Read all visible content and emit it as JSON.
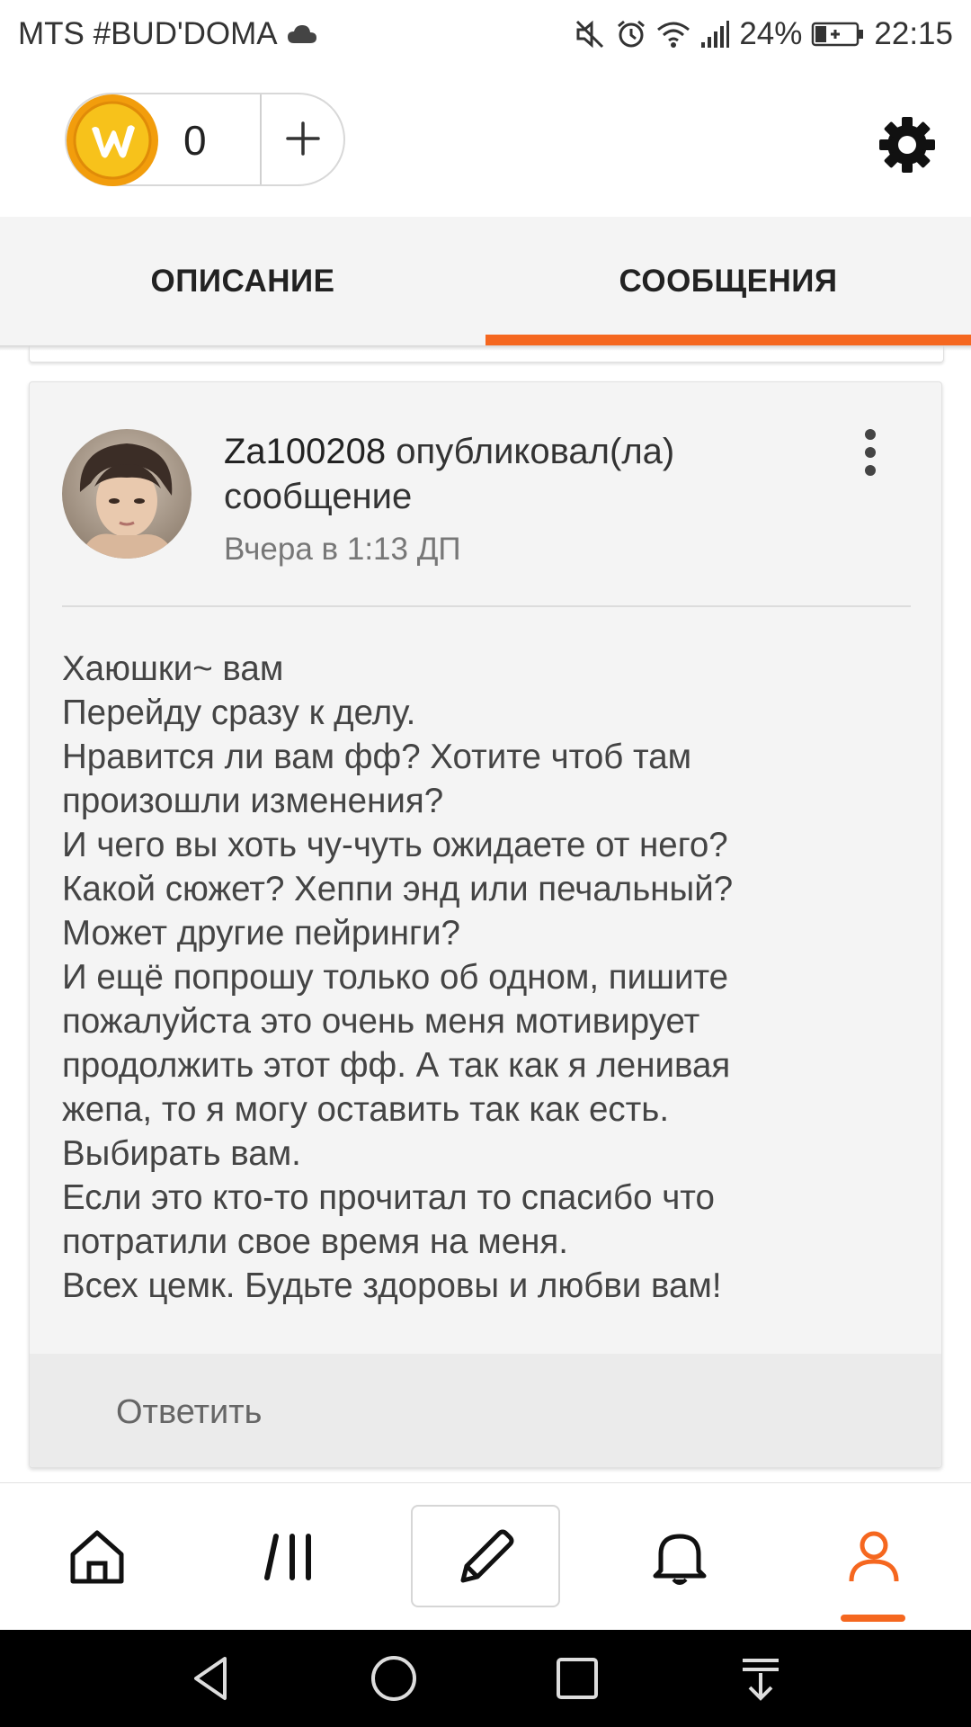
{
  "status_bar": {
    "carrier": "MTS #BUD'DOMA",
    "battery": "24%",
    "time": "22:15",
    "icons": [
      "cloud-icon",
      "mute-icon",
      "alarm-icon",
      "wifi-icon",
      "signal-icon",
      "battery-icon"
    ]
  },
  "topbar": {
    "coin_count": "0",
    "coin_icon": "wattpad-coin-icon",
    "add_icon": "plus-icon",
    "settings_icon": "gear-icon"
  },
  "tabs": [
    {
      "label": "ОПИСАНИЕ",
      "active": false
    },
    {
      "label": "СООБЩЕНИЯ",
      "active": true
    }
  ],
  "message": {
    "author": "Za100208",
    "action": "опубликовал(ла) сообщение",
    "timestamp": "Вчера в 1:13 ДП",
    "body_lines": [
      "Хаюшки~ вам",
      "Перейду сразу к делу.",
      "Нравится ли вам фф? Хотите чтоб там",
      "произошли изменения?",
      "И чего вы хоть чу-чуть ожидаете от него?",
      "Какой сюжет? Хеппи энд или печальный?",
      "Может другие пейринги?",
      "И ещё попрошу только об одном, пишите",
      "пожалуйста это очень меня мотивирует",
      "продолжить этот фф. А так как я ленивая",
      "жепа, то я могу оставить так как есть.",
      "Выбирать вам.",
      "Если это кто-то прочитал то спасибо что",
      "потратили свое время на меня.",
      "Всех цемк. Будьте здоровы и любви вам!"
    ],
    "reply_label": "Ответить"
  },
  "bottom_nav": [
    {
      "icon": "home-icon",
      "active": false
    },
    {
      "icon": "library-icon",
      "active": false
    },
    {
      "icon": "pencil-icon",
      "active": false
    },
    {
      "icon": "bell-icon",
      "active": false
    },
    {
      "icon": "profile-icon",
      "active": true
    }
  ],
  "system_nav": [
    "back-icon",
    "home-circle-icon",
    "recents-icon",
    "notification-pull-icon"
  ],
  "colors": {
    "accent": "#f5671f",
    "coin": "#f5b50f",
    "tab_bg": "#f4f4f4",
    "card_bg": "#f4f4f4"
  }
}
